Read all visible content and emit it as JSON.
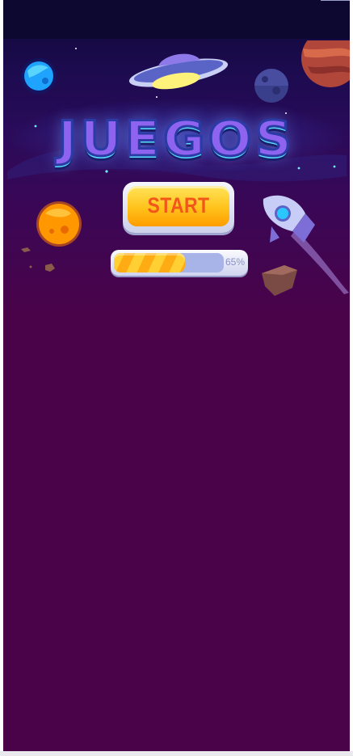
{
  "game": {
    "title": "JUEGOS",
    "start_label": "START",
    "loading": {
      "value": 0.65,
      "label": "65%"
    }
  },
  "colors": {
    "background": "#4a0349",
    "accent_yellow": "#ffc21a",
    "start_text": "#f2561b",
    "title_fill": "#8d63f0"
  },
  "icons": [
    "ufo-icon",
    "blue-planet-icon",
    "moon-icon",
    "red-planet-icon",
    "orange-planet-icon",
    "rocket-icon",
    "asteroid-icon"
  ]
}
